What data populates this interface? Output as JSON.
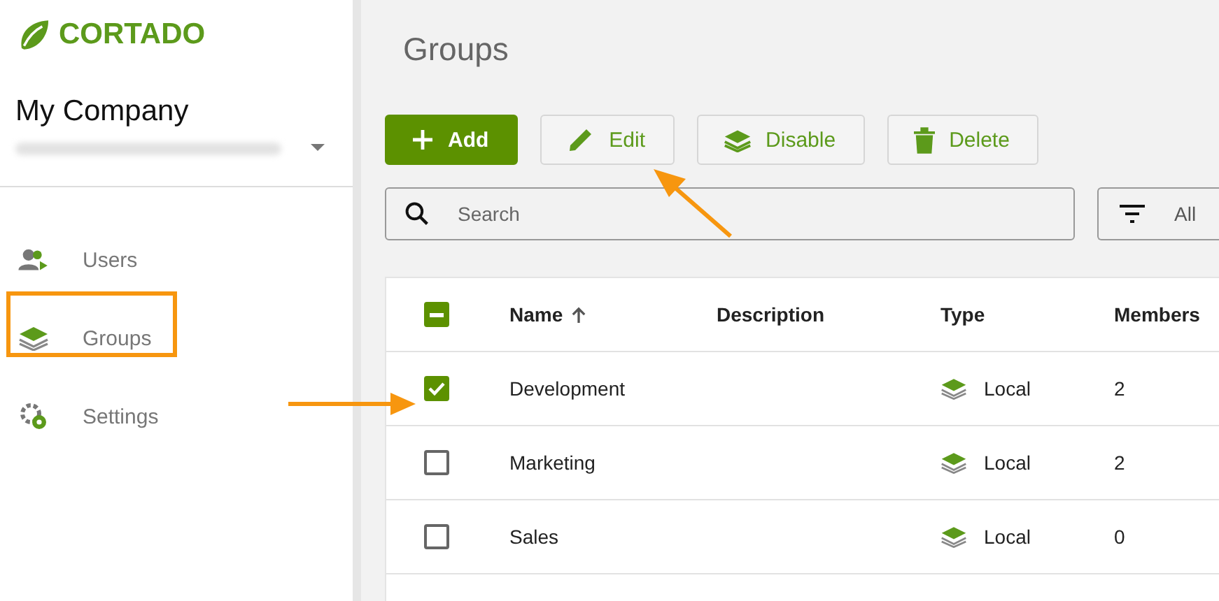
{
  "sidebar": {
    "logo": "CORTADO",
    "company": "My Company",
    "items": [
      {
        "label": "Users",
        "kind": "users"
      },
      {
        "label": "Groups",
        "kind": "groups"
      },
      {
        "label": "Settings",
        "kind": "settings"
      }
    ]
  },
  "page_title": "Groups",
  "toolbar": [
    {
      "label": "Add",
      "kind": "add"
    },
    {
      "label": "Edit",
      "kind": "edit"
    },
    {
      "label": "Disable",
      "kind": "disable"
    },
    {
      "label": "Delete",
      "kind": "delete"
    }
  ],
  "search": {
    "placeholder": "Search"
  },
  "filter": {
    "value": "All"
  },
  "table": {
    "select_all": {
      "checked": true,
      "indeterminate": true
    },
    "columns": [
      {
        "label": "Name",
        "sorted": true
      },
      {
        "label": "Description",
        "sorted": false
      },
      {
        "label": "Type",
        "sorted": false
      },
      {
        "label": "Members",
        "sorted": false
      }
    ],
    "rows": [
      {
        "checked": true,
        "name": "Development",
        "type": "Local",
        "members": "2"
      },
      {
        "checked": false,
        "name": "Marketing",
        "type": "Local",
        "members": "2"
      },
      {
        "checked": false,
        "name": "Sales",
        "type": "Local",
        "members": "0"
      }
    ]
  }
}
